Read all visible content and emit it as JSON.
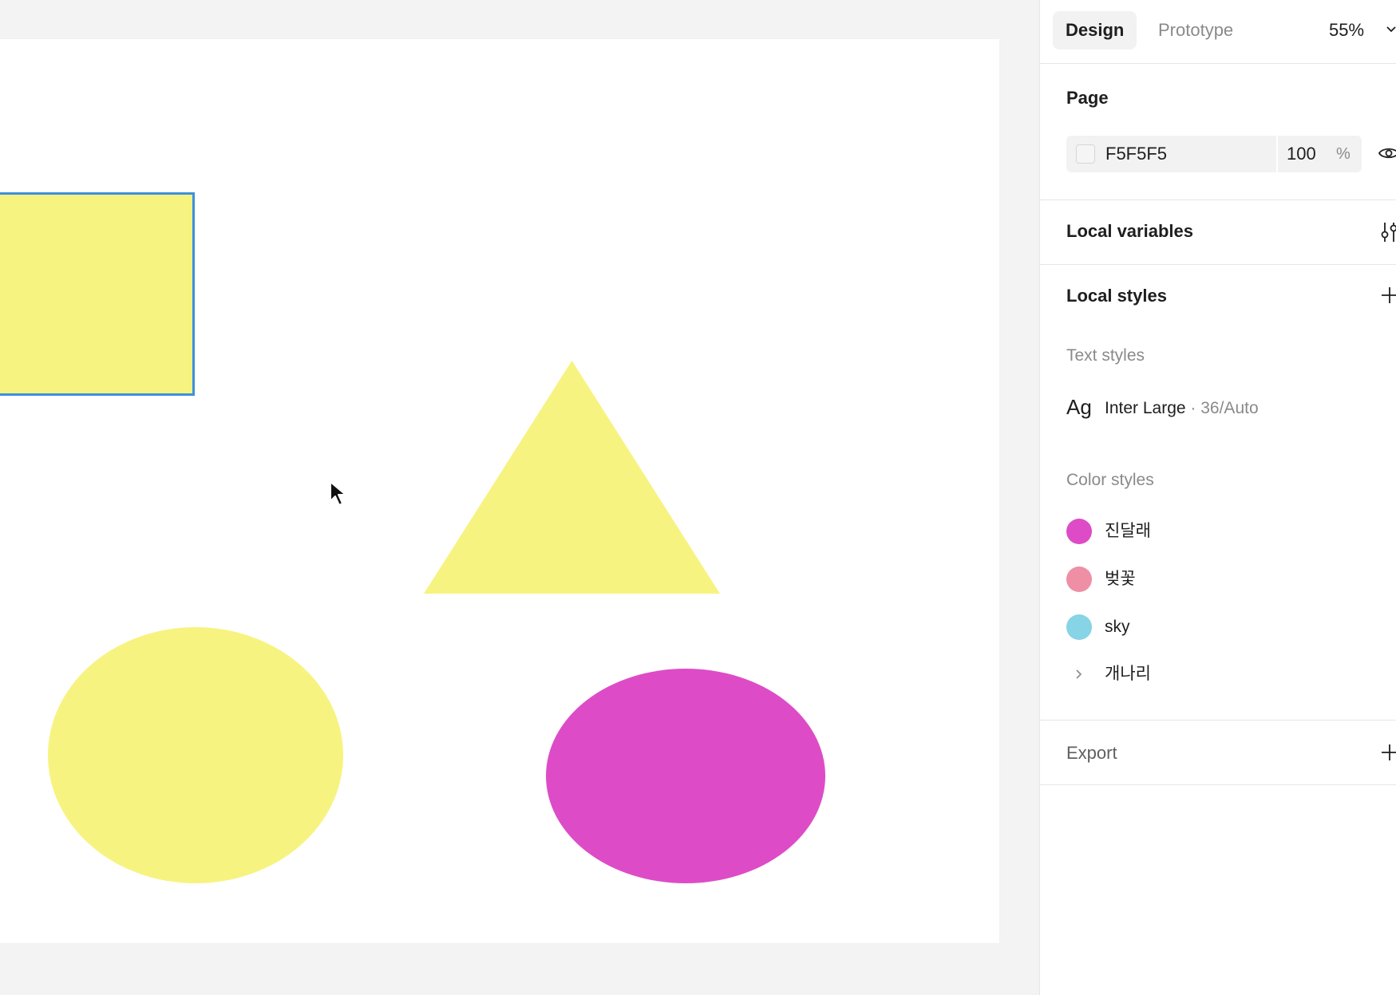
{
  "tabs": {
    "design": "Design",
    "prototype": "Prototype"
  },
  "zoom": "55%",
  "page": {
    "title": "Page",
    "fill_hex": "F5F5F5",
    "opacity": "100",
    "percent_sign": "%"
  },
  "local_variables": {
    "title": "Local variables"
  },
  "local_styles": {
    "title": "Local styles",
    "text_styles_label": "Text styles",
    "text_style": {
      "preview": "Ag",
      "name": "Inter Large",
      "meta": " · 36/Auto"
    },
    "color_styles_label": "Color styles",
    "colors": [
      {
        "name": "진달래",
        "hex": "#dd4cc6"
      },
      {
        "name": "벚꽃",
        "hex": "#ee8fa6"
      },
      {
        "name": "sky",
        "hex": "#86d4e5"
      },
      {
        "name": "개나리",
        "group": true
      }
    ]
  },
  "export": {
    "title": "Export"
  },
  "canvas": {
    "shape_colors": {
      "yellow": "#f7f380",
      "magenta": "#dd4cc6",
      "selection": "#3d8fde"
    }
  }
}
